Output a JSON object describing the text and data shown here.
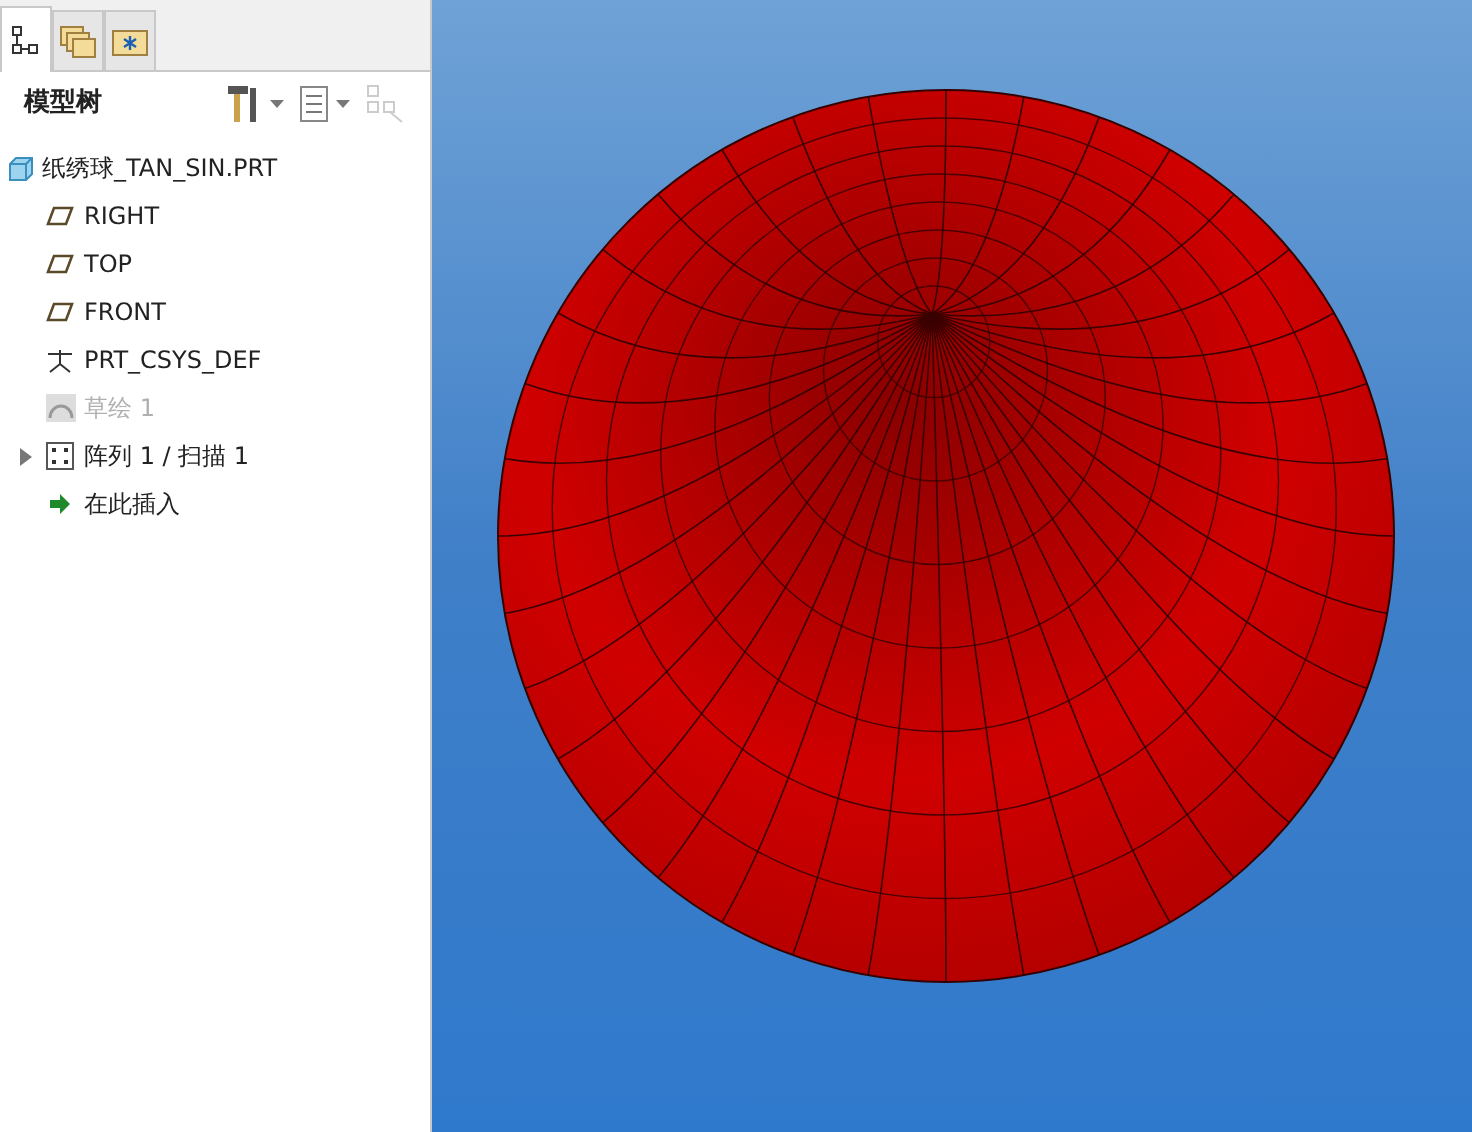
{
  "tabs": [
    {
      "kind": "tree",
      "selected": true
    },
    {
      "kind": "layers",
      "selected": false
    },
    {
      "kind": "favorites",
      "selected": false
    }
  ],
  "panel": {
    "title": "模型树"
  },
  "tree": {
    "label": "纸绣球_TAN_SIN.PRT",
    "kind": "part",
    "children": [
      {
        "label": "RIGHT",
        "kind": "plane",
        "disabled": false
      },
      {
        "label": "TOP",
        "kind": "plane",
        "disabled": false
      },
      {
        "label": "FRONT",
        "kind": "plane",
        "disabled": false
      },
      {
        "label": "PRT_CSYS_DEF",
        "kind": "csys",
        "disabled": false
      },
      {
        "label": "草绘 1",
        "kind": "sketch",
        "disabled": true
      },
      {
        "label": "阵列 1 / 扫描 1",
        "kind": "pattern",
        "disabled": false,
        "expanded": false
      },
      {
        "label": "在此插入",
        "kind": "insert",
        "disabled": false
      }
    ]
  }
}
